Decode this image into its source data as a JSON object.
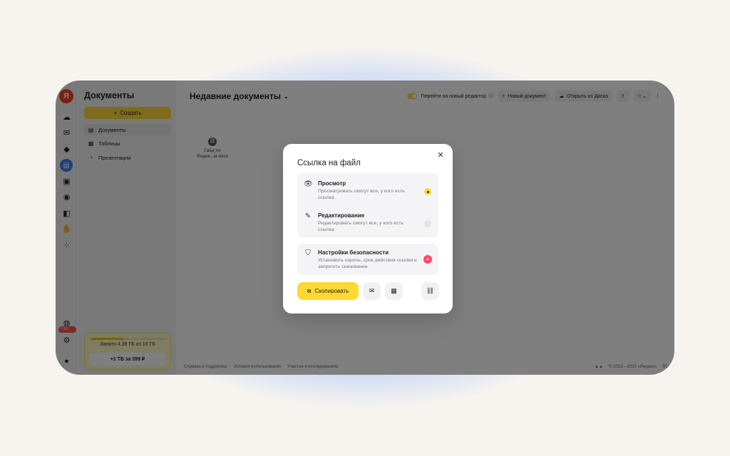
{
  "app": {
    "sidebar_title": "Документы",
    "create_label": "Создать",
    "nav": [
      {
        "icon": "document-icon",
        "label": "Документы",
        "active": true
      },
      {
        "icon": "table-icon",
        "label": "Таблицы",
        "active": false
      },
      {
        "icon": "presentation-icon",
        "label": "Презентации",
        "active": false
      }
    ],
    "rail_badge": "+10 ГБ",
    "storage": {
      "used_text": "Занято 4,38 ГБ из 10 ГБ",
      "used_fraction": 0.438,
      "buy_label": "+1 ТБ за 399 ₽"
    }
  },
  "main": {
    "title": "Недавние документы",
    "toggle_label": "Перейти на новый редактор",
    "new_doc_label": "Новый документ",
    "open_disk_label": "Открыть из Диска",
    "file": {
      "name_line1": "Гайд по",
      "name_line2": "Яндек...м.docx"
    }
  },
  "footer": {
    "links": [
      "Справка и поддержка",
      "Условия использования",
      "Участие в исследованиях"
    ],
    "copyright": "© 2012—2025 «Яндекс»",
    "lang": "RU"
  },
  "modal": {
    "title": "Ссылка на файл",
    "options": [
      {
        "title": "Просмотр",
        "desc": "Просматривать смогут все, у кого есть ссылка",
        "selected": true
      },
      {
        "title": "Редактирование",
        "desc": "Редактировать смогут все, у кого есть ссылка",
        "selected": false
      }
    ],
    "security": {
      "title": "Настройки безопасности",
      "desc": "Установить пароль, срок действия ссылки и запретить скачивание"
    },
    "copy_label": "Скопировать"
  },
  "colors": {
    "accent": "#fdd835",
    "rail_active": "#3d7ff2",
    "lock": "#ff4a68"
  }
}
